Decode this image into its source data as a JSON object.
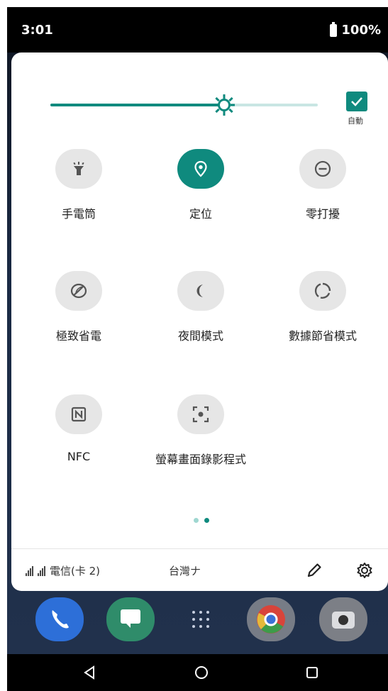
{
  "status_bar": {
    "time": "3:01",
    "battery": "100%"
  },
  "brightness": {
    "level": 0.65,
    "auto_label": "自動",
    "auto_checked": true
  },
  "tiles": [
    {
      "label": "手電筒",
      "icon": "flashlight-icon",
      "active": false
    },
    {
      "label": "定位",
      "icon": "location-pin-icon",
      "active": true
    },
    {
      "label": "零打擾",
      "icon": "do-not-disturb-icon",
      "active": false
    },
    {
      "label": "極致省電",
      "icon": "leaf-icon",
      "active": false
    },
    {
      "label": "夜間模式",
      "icon": "moon-icon",
      "active": false
    },
    {
      "label": "數據節省模式",
      "icon": "data-saver-icon",
      "active": false
    },
    {
      "label": "NFC",
      "icon": "nfc-icon",
      "active": false
    },
    {
      "label": "螢幕畫面錄影程式",
      "icon": "screen-record-icon",
      "active": false
    }
  ],
  "pager": {
    "pages": 2,
    "current": 2
  },
  "footer": {
    "carrier_1": "電信(卡 2)",
    "carrier_2": "台灣ナ"
  },
  "colors": {
    "accent": "#0f8a7e",
    "accent_light": "#c9e6e3",
    "tile_bg": "#e6e6e6"
  }
}
